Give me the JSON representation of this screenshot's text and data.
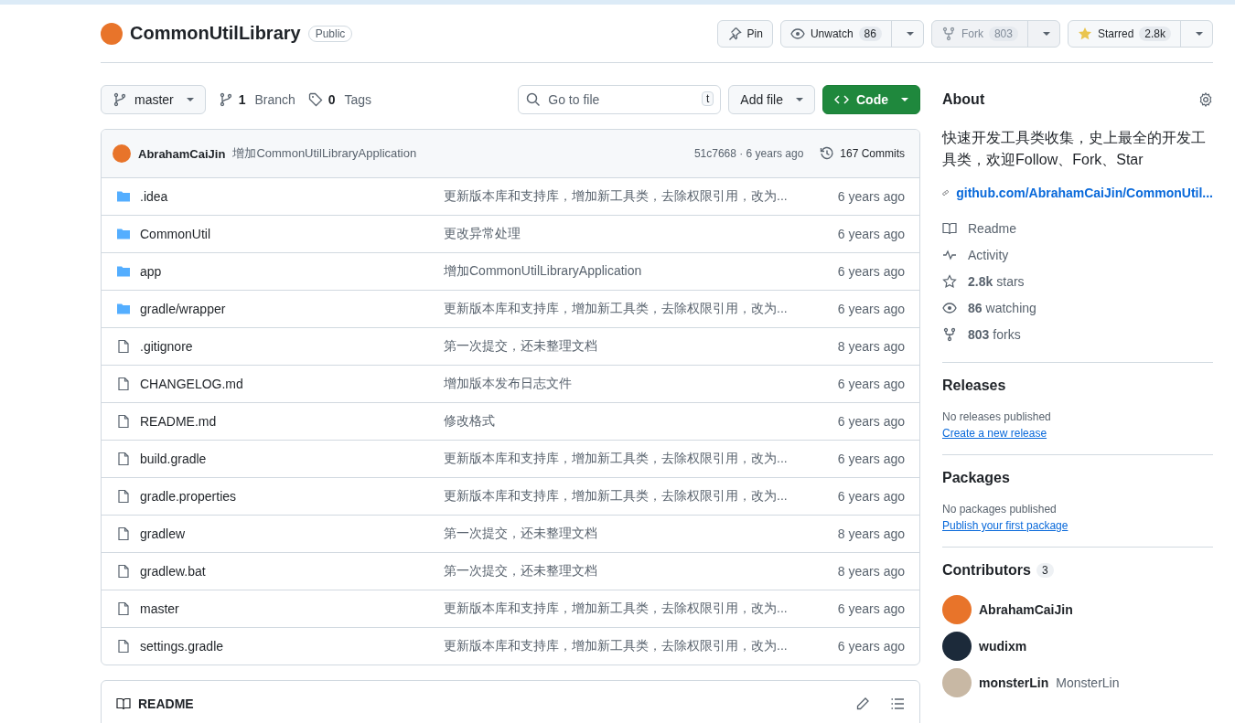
{
  "repo": {
    "name": "CommonUtilLibrary",
    "visibility": "Public"
  },
  "actions": [
    {
      "kind": "pin",
      "label": "Pin"
    },
    {
      "kind": "watch",
      "label": "Unwatch",
      "count": "86"
    },
    {
      "kind": "fork",
      "label": "Fork",
      "count": "803",
      "disabled": true
    },
    {
      "kind": "star",
      "label": "Starred",
      "count": "2.8k"
    }
  ],
  "toolbar": {
    "branch": "master",
    "branches_count": "1",
    "branches_label": "Branch",
    "tags_count": "0",
    "tags_label": "Tags",
    "search": {
      "placeholder": "Go to file",
      "shortcut": "t"
    },
    "add_file": "Add file",
    "code": "Code"
  },
  "commit": {
    "author": "AbrahamCaiJin",
    "message": "增加CommonUtilLibraryApplication",
    "meta": "51c7668 · 6 years ago",
    "commits": "167 Commits"
  },
  "files": [
    {
      "kind": "folder",
      "name": ".idea",
      "message": "更新版本库和支持库，增加新工具类，去除权限引用，改为...",
      "time": "6 years ago"
    },
    {
      "kind": "folder",
      "name": "CommonUtil",
      "message": "更改异常处理",
      "time": "6 years ago"
    },
    {
      "kind": "folder",
      "name": "app",
      "message": "增加CommonUtilLibraryApplication",
      "time": "6 years ago"
    },
    {
      "kind": "folder",
      "name": "gradle/wrapper",
      "message": "更新版本库和支持库，增加新工具类，去除权限引用，改为...",
      "time": "6 years ago"
    },
    {
      "kind": "file",
      "name": ".gitignore",
      "message": "第一次提交，还未整理文档",
      "time": "8 years ago"
    },
    {
      "kind": "file",
      "name": "CHANGELOG.md",
      "message": "增加版本发布日志文件",
      "time": "6 years ago"
    },
    {
      "kind": "file",
      "name": "README.md",
      "message": "修改格式",
      "time": "6 years ago"
    },
    {
      "kind": "file",
      "name": "build.gradle",
      "message": "更新版本库和支持库，增加新工具类，去除权限引用，改为...",
      "time": "6 years ago"
    },
    {
      "kind": "file",
      "name": "gradle.properties",
      "message": "更新版本库和支持库，增加新工具类，去除权限引用，改为...",
      "time": "6 years ago"
    },
    {
      "kind": "file",
      "name": "gradlew",
      "message": "第一次提交，还未整理文档",
      "time": "8 years ago"
    },
    {
      "kind": "file",
      "name": "gradlew.bat",
      "message": "第一次提交，还未整理文档",
      "time": "8 years ago"
    },
    {
      "kind": "file",
      "name": "master",
      "message": "更新版本库和支持库，增加新工具类，去除权限引用，改为...",
      "time": "6 years ago"
    },
    {
      "kind": "file",
      "name": "settings.gradle",
      "message": "更新版本库和支持库，增加新工具类，去除权限引用，改为...",
      "time": "6 years ago"
    }
  ],
  "readme": {
    "title": "README"
  },
  "about": {
    "title": "About",
    "description": "快速开发工具类收集，史上最全的开发工具类，欢迎Follow、Fork、Star",
    "link": "github.com/AbrahamCaiJin/CommonUtil...",
    "stats": [
      {
        "kind": "readme",
        "label": "Readme"
      },
      {
        "kind": "activity",
        "label": "Activity"
      },
      {
        "kind": "stars",
        "count": "2.8k",
        "label": "stars"
      },
      {
        "kind": "watching",
        "count": "86",
        "label": "watching"
      },
      {
        "kind": "forks",
        "count": "803",
        "label": "forks"
      }
    ]
  },
  "releases": {
    "title": "Releases",
    "note": "No releases published",
    "link": "Create a new release"
  },
  "packages": {
    "title": "Packages",
    "note": "No packages published",
    "link": "Publish your first package"
  },
  "contributors": {
    "title": "Contributors",
    "count": "3",
    "people": [
      {
        "login": "AbrahamCaiJin",
        "color": "#e8742a"
      },
      {
        "login": "wudixm",
        "color": "#1c2a3a"
      },
      {
        "login": "monsterLin",
        "name": "MonsterLin",
        "color": "#c8b8a4"
      }
    ]
  }
}
